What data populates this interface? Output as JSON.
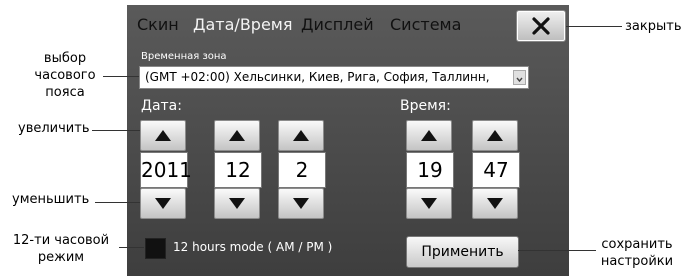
{
  "tabs": [
    "Скин",
    "Дата/Время",
    "Дисплей",
    "Система"
  ],
  "timezone": {
    "label": "Временная зона",
    "value": "(GMT +02:00) Хельсинки, Киев, Рига, София, Таллинн,"
  },
  "date": {
    "label": "Дата:",
    "year": "2011",
    "month": "12",
    "day": "2"
  },
  "time": {
    "label": "Время:",
    "hour": "19",
    "minute": "47"
  },
  "mode12": {
    "label": "12 hours mode ( AM / PM )",
    "checked": false
  },
  "apply_label": "Применить",
  "annotations": {
    "close": "закрыть",
    "tz_line1": "выбор",
    "tz_line2": "часового",
    "tz_line3": "пояса",
    "increase": "увеличить",
    "decrease": "уменьшить",
    "mode_line1": "12-ти часовой",
    "mode_line2": "режим",
    "save_line1": "сохранить",
    "save_line2": "настройки"
  },
  "icons": {
    "close": "close-icon",
    "up": "arrow-up-icon",
    "down": "arrow-down-icon",
    "dropdown": "chevron-down-icon"
  }
}
